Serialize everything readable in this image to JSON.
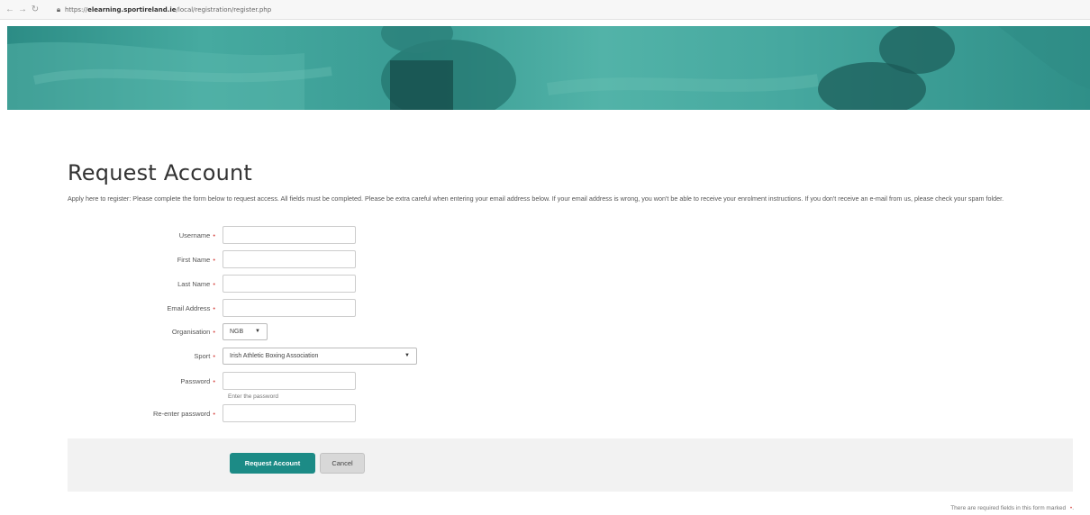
{
  "browser": {
    "back_icon": "arrow-left-icon",
    "forward_icon": "arrow-right-icon",
    "reload_icon": "reload-icon",
    "lock_icon": "lock-icon",
    "url_scheme": "https://",
    "url_host": "elearning.sportireland.ie",
    "url_path": "/local/registration/register.php"
  },
  "page": {
    "title": "Request Account",
    "intro": "Apply here to register: Please complete the form below to request access. All fields must be completed. Please be extra careful when entering your email address below. If your email address is wrong, you won't be able to receive your enrolment instructions. If you don't receive an e-mail from us, please check your spam folder."
  },
  "form": {
    "required_marker": "•",
    "username_label": "Username",
    "firstname_label": "First Name",
    "lastname_label": "Last Name",
    "email_label": "Email Address",
    "organisation_label": "Organisation",
    "organisation_value": "NGB",
    "sport_label": "Sport",
    "sport_value": "Irish Athletic Boxing Association",
    "password_label": "Password",
    "password_help": "Enter the password",
    "repassword_label": "Re-enter password",
    "submit_label": "Request Account",
    "cancel_label": "Cancel",
    "required_note": "There are required fields in this form marked",
    "dropdown_icon": "caret-down-icon"
  },
  "colors": {
    "accent": "#1c8b86",
    "hero": "#46aaa0",
    "required": "#d9534f"
  }
}
